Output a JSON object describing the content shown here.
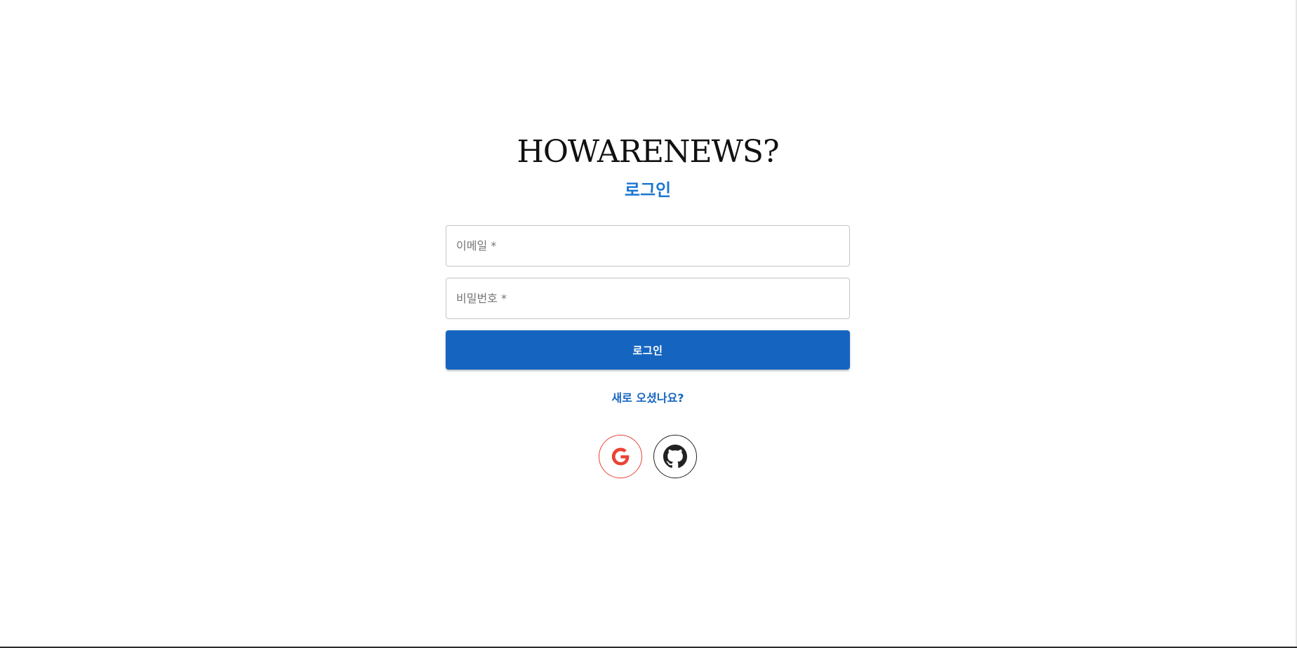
{
  "brand": {
    "logo_text": "HOWARENEWS?"
  },
  "login_form": {
    "heading": "로그인",
    "email_placeholder": "이메일 *",
    "email_value": "",
    "password_placeholder": "비밀번호 *",
    "password_value": "",
    "submit_label": "로그인",
    "signup_link_text": "새로 오셨나요?"
  },
  "social_login": {
    "providers": [
      {
        "icon": "google-icon",
        "color": "#ea4335"
      },
      {
        "icon": "github-icon",
        "color": "#222222"
      }
    ]
  },
  "colors": {
    "primary": "#1565c0",
    "heading": "#1976d2",
    "input_border": "#c4c4c4",
    "google": "#ea4335"
  }
}
